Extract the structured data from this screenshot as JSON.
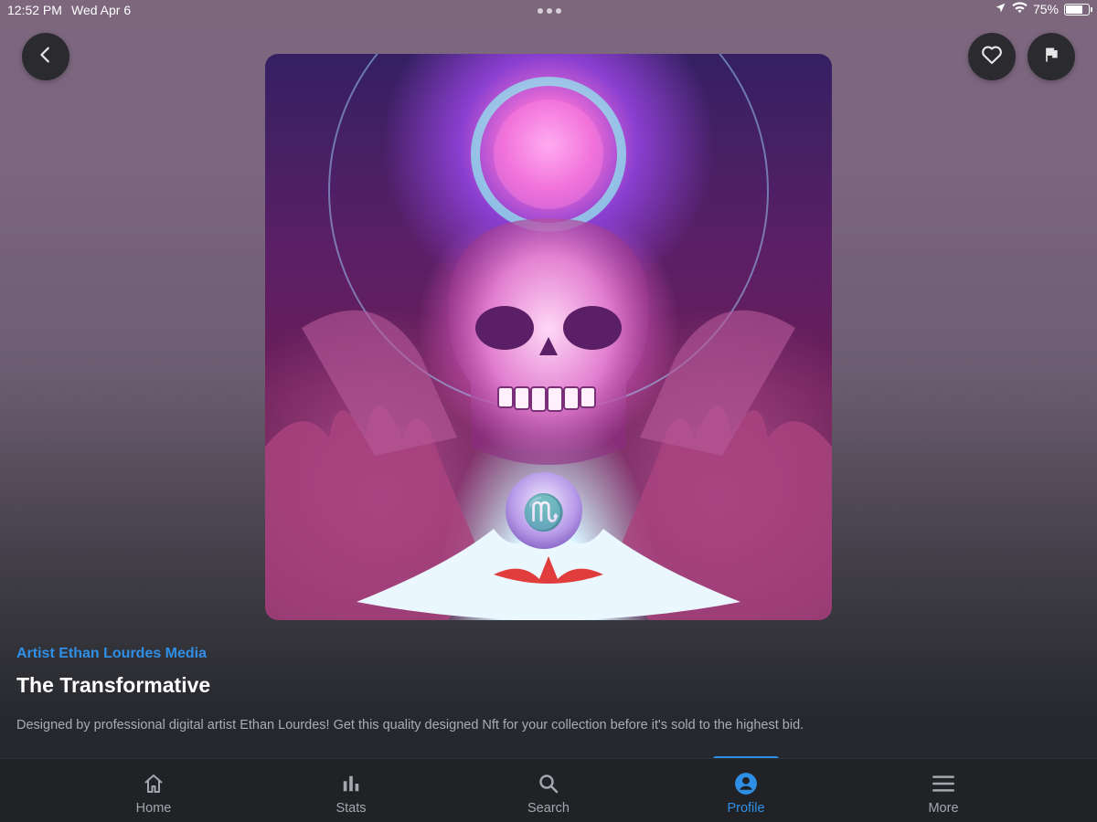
{
  "status_bar": {
    "time": "12:52 PM",
    "date": "Wed Apr 6",
    "battery": "75%",
    "battery_level": 0.75
  },
  "header": {
    "back_icon": "chevron-left-icon",
    "favorite_icon": "heart-icon",
    "report_icon": "flag-icon"
  },
  "artwork": {
    "subject": "psychedelic crystal skull with hands, lotus flower and orb"
  },
  "details": {
    "artist": "Artist Ethan Lourdes Media",
    "title": "The Transformative",
    "description": "Designed by professional digital artist Ethan Lourdes! Get this quality designed Nft for your collection before it's sold to the highest bid."
  },
  "tabs": [
    {
      "label": "Home",
      "icon": "home-icon"
    },
    {
      "label": "Stats",
      "icon": "bar-chart-icon"
    },
    {
      "label": "Search",
      "icon": "search-icon"
    },
    {
      "label": "Profile",
      "icon": "profile-icon",
      "active": true
    },
    {
      "label": "More",
      "icon": "menu-icon"
    }
  ],
  "colors": {
    "accent": "#2f8fe6",
    "tabbar_bg": "#202226",
    "button_bg": "#2b2a2f"
  }
}
